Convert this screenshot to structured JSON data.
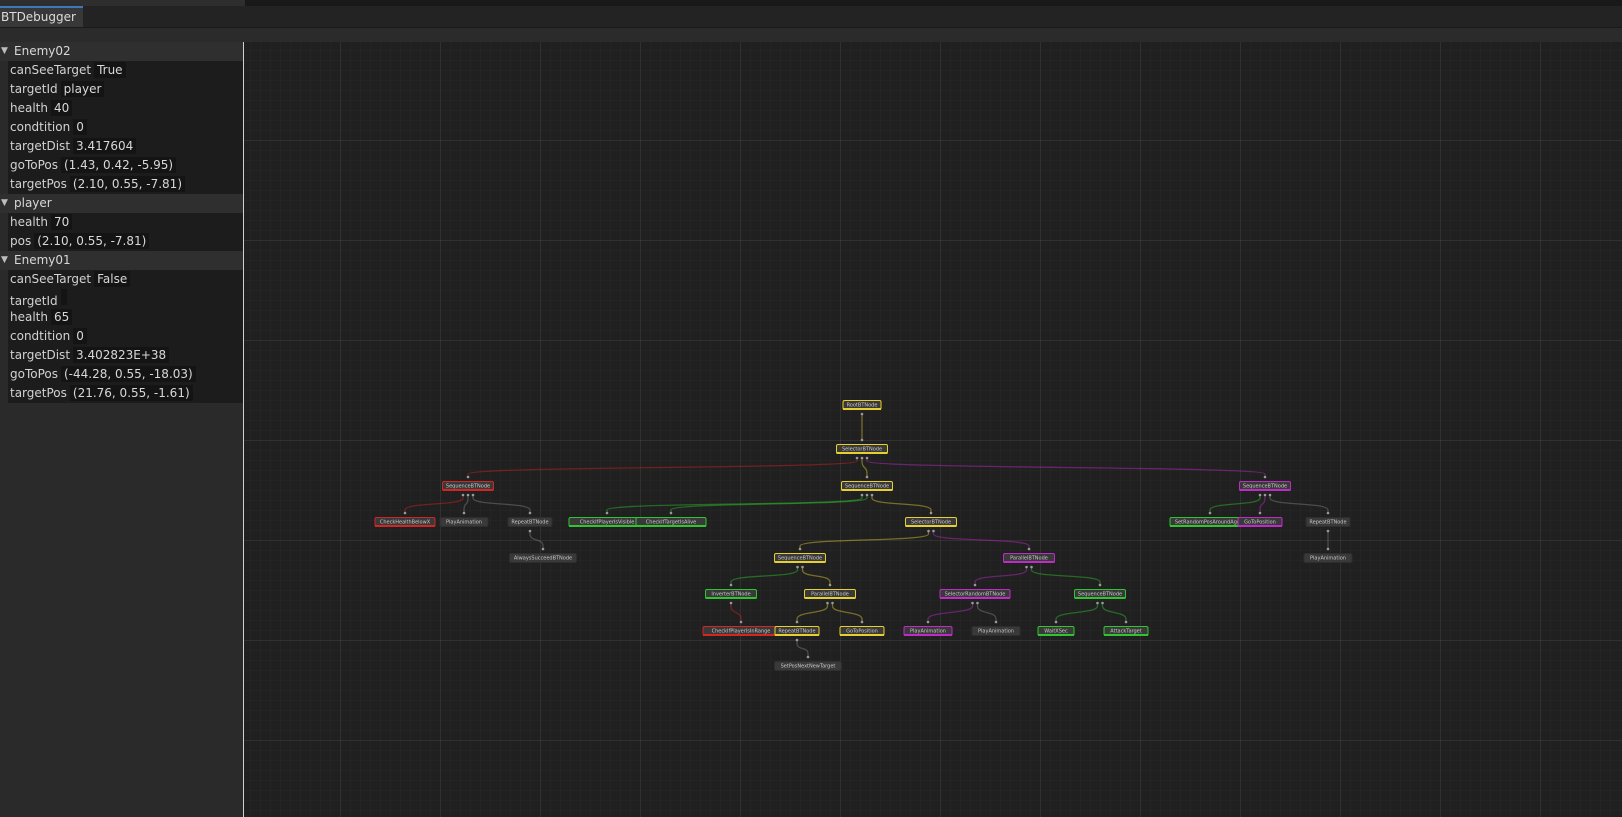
{
  "window": {
    "tab_title": "BTDebugger"
  },
  "entities": [
    {
      "name": "Enemy02",
      "props": [
        {
          "key": "canSeeTarget",
          "value": "True"
        },
        {
          "key": "targetId",
          "value": "player"
        },
        {
          "key": "health",
          "value": "40"
        },
        {
          "key": "condtition",
          "value": "0"
        },
        {
          "key": "targetDist",
          "value": "3.417604"
        },
        {
          "key": "goToPos",
          "value": "(1.43, 0.42, -5.95)"
        },
        {
          "key": "targetPos",
          "value": "(2.10, 0.55, -7.81)"
        }
      ]
    },
    {
      "name": "player",
      "props": [
        {
          "key": "health",
          "value": "70"
        },
        {
          "key": "pos",
          "value": "(2.10, 0.55, -7.81)"
        }
      ]
    },
    {
      "name": "Enemy01",
      "props": [
        {
          "key": "canSeeTarget",
          "value": "False"
        },
        {
          "key": "targetId",
          "value": ""
        },
        {
          "key": "health",
          "value": "65"
        },
        {
          "key": "condtition",
          "value": "0"
        },
        {
          "key": "targetDist",
          "value": "3.402823E+38"
        },
        {
          "key": "goToPos",
          "value": "(-44.28, 0.55, -18.03)"
        },
        {
          "key": "targetPos",
          "value": "(21.76, 0.55, -1.61)"
        }
      ]
    }
  ],
  "colors": {
    "running": "#e6cf2e",
    "success": "#2ec62e",
    "failure": "#d42424",
    "other": "#c02ac9",
    "idle": "#6a6a6a"
  },
  "tree": {
    "label": "RootBTNode",
    "status": "running",
    "children": [
      {
        "label": "SelectorBTNode",
        "status": "running",
        "children": [
          {
            "label": "SequenceBTNode",
            "status": "failure",
            "children": [
              {
                "label": "CheckHealthBelowX",
                "status": "failure"
              },
              {
                "label": "PlayAnimation",
                "status": "idle"
              },
              {
                "label": "RepeatBTNode",
                "status": "idle",
                "children": [
                  {
                    "label": "AlwaysSucceedBTNode",
                    "status": "idle"
                  }
                ]
              }
            ]
          },
          {
            "label": "SequenceBTNode",
            "status": "running",
            "children": [
              {
                "label": "CheckIfPlayerIsVisible",
                "status": "success"
              },
              {
                "label": "CheckIfTargetIsAlive",
                "status": "success"
              },
              {
                "label": "SelectorBTNode",
                "status": "running",
                "children": [
                  {
                    "label": "SequenceBTNode",
                    "status": "running",
                    "children": [
                      {
                        "label": "InverterBTNode",
                        "status": "success",
                        "children": [
                          {
                            "label": "CheckIfPlayerIsInRange",
                            "status": "failure"
                          }
                        ]
                      },
                      {
                        "label": "ParallelBTNode",
                        "status": "running",
                        "children": [
                          {
                            "label": "RepeatBTNode",
                            "status": "running",
                            "children": [
                              {
                                "label": "SetPosNextNewTarget",
                                "status": "idle"
                              }
                            ]
                          },
                          {
                            "label": "GoToPosition",
                            "status": "running"
                          }
                        ]
                      }
                    ]
                  },
                  {
                    "label": "ParallelBTNode",
                    "status": "other",
                    "children": [
                      {
                        "label": "SelectorRandomBTNode",
                        "status": "other",
                        "children": [
                          {
                            "label": "PlayAnimation",
                            "status": "other"
                          },
                          {
                            "label": "PlayAnimation",
                            "status": "idle"
                          }
                        ]
                      },
                      {
                        "label": "SequenceBTNode",
                        "status": "success",
                        "children": [
                          {
                            "label": "WaitXSec",
                            "status": "success"
                          },
                          {
                            "label": "AttackTarget",
                            "status": "success"
                          }
                        ]
                      }
                    ]
                  }
                ]
              }
            ]
          },
          {
            "label": "SequenceBTNode",
            "status": "other",
            "children": [
              {
                "label": "SetRandomPosAroundAgent",
                "status": "success"
              },
              {
                "label": "GoToPosition",
                "status": "other"
              },
              {
                "label": "RepeatBTNode",
                "status": "idle",
                "children": [
                  {
                    "label": "PlayAnimation",
                    "status": "idle"
                  }
                ]
              }
            ]
          }
        ]
      }
    ]
  }
}
